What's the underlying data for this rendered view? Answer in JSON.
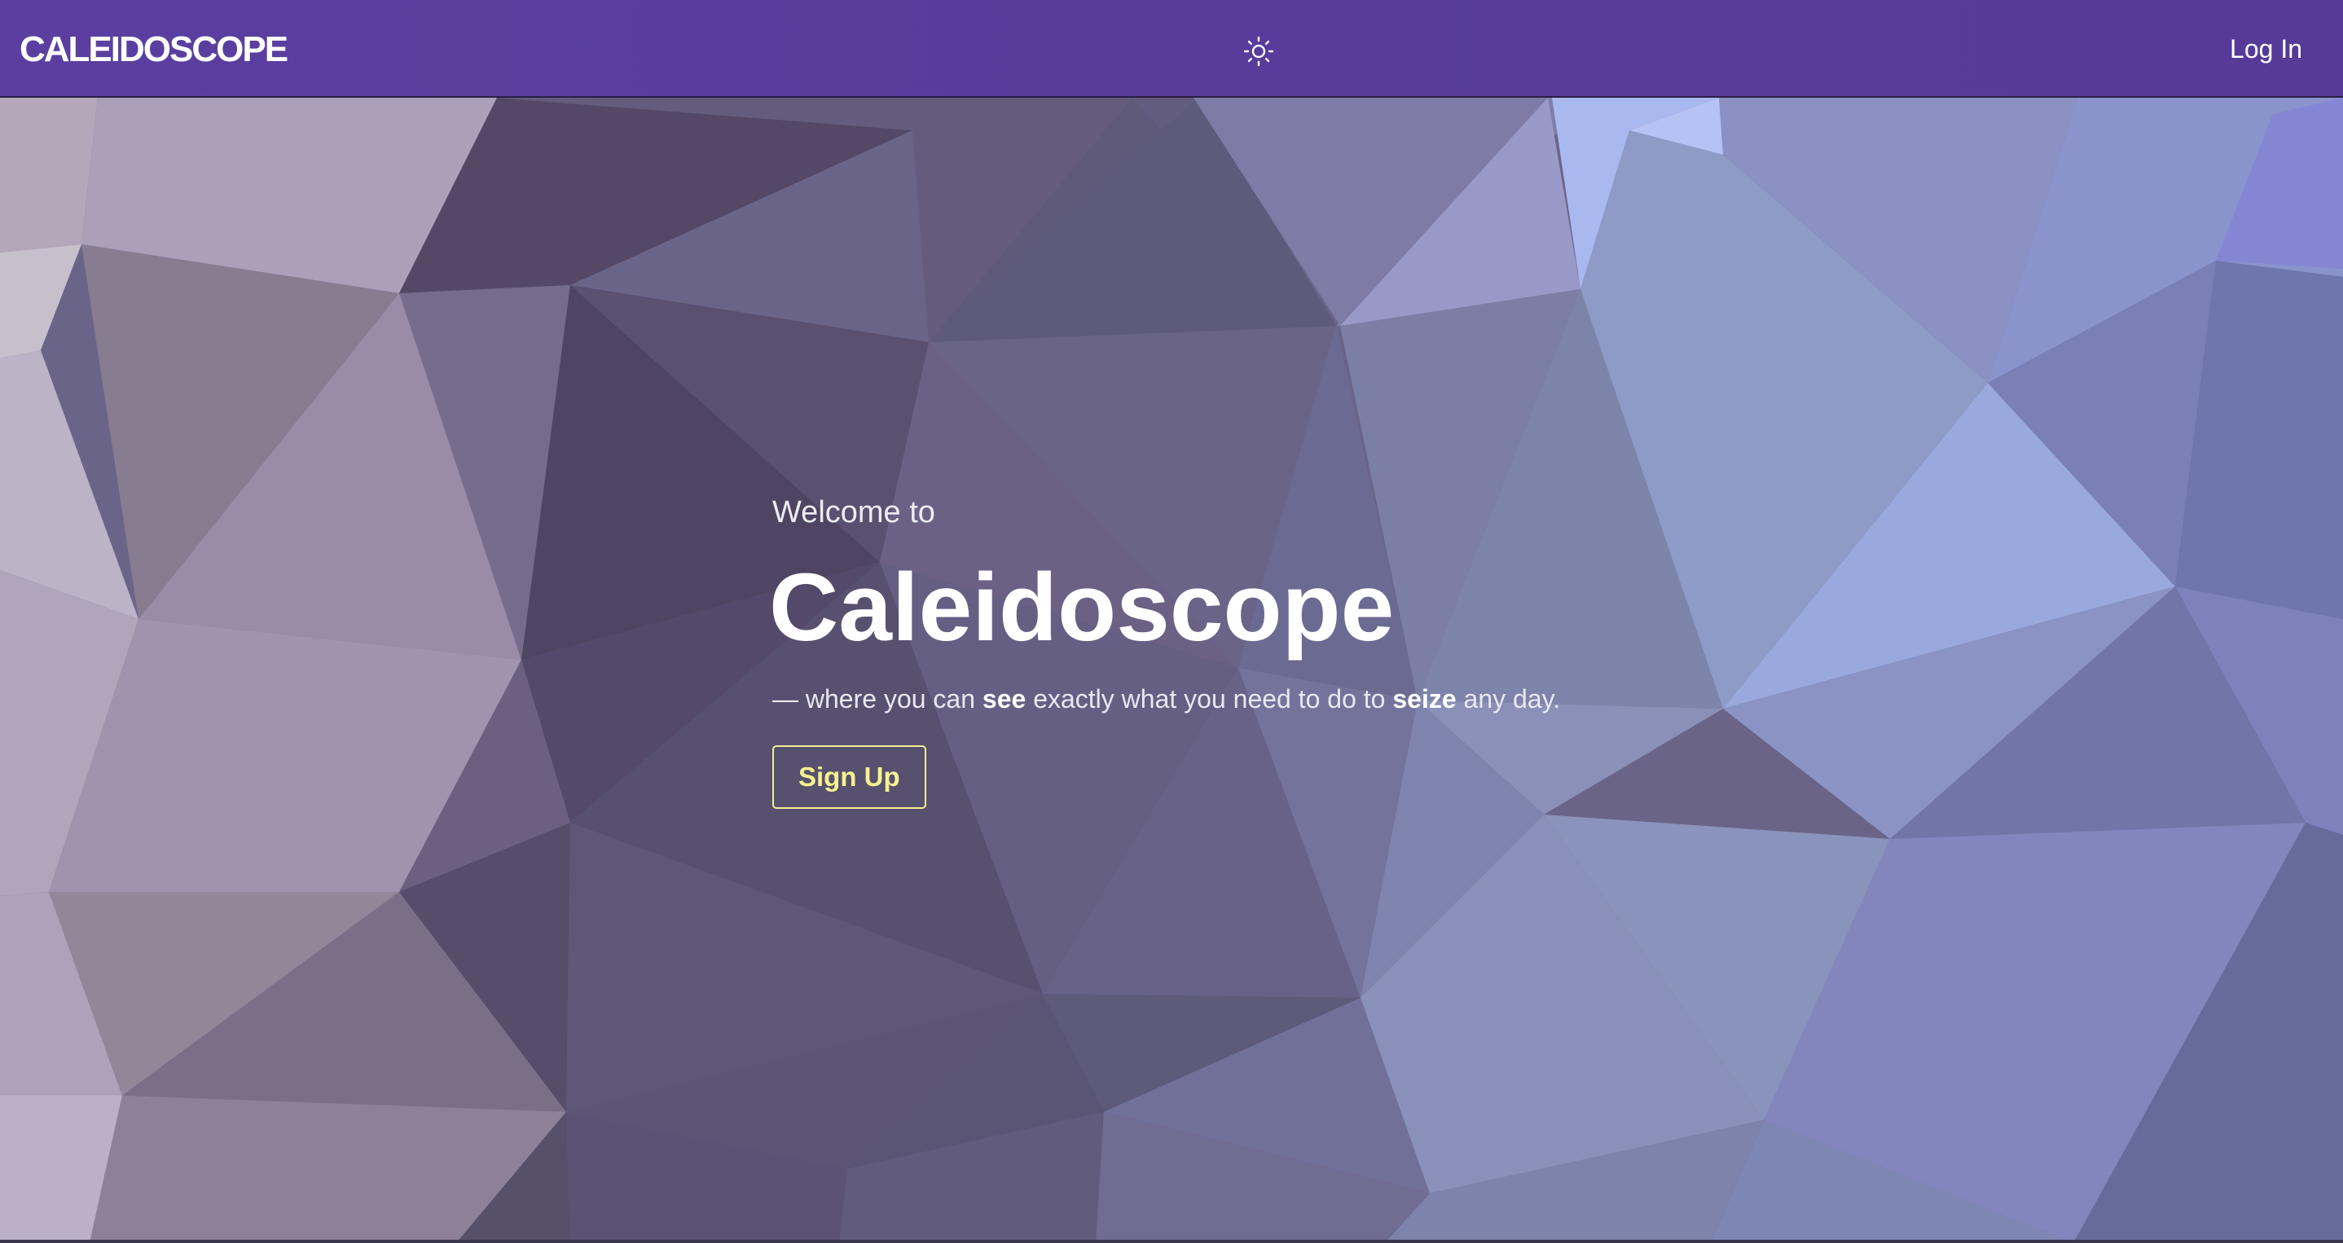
{
  "navbar": {
    "brand": "CALEIDOSCOPE",
    "theme_toggle_icon": "sun-icon",
    "login_label": "Log In",
    "background": "#563c9b"
  },
  "hero": {
    "welcome": "Welcome to",
    "title": "Caleidoscope",
    "tagline": {
      "prefix": "— where you can ",
      "word1": "see",
      "middle": " exactly what you need to do to ",
      "word2": "seize",
      "suffix": " any day."
    },
    "signup_label": "Sign Up",
    "signup_color": "#f6f28f",
    "background_pattern": "low-poly triangles, mauve to periwinkle gradient"
  }
}
